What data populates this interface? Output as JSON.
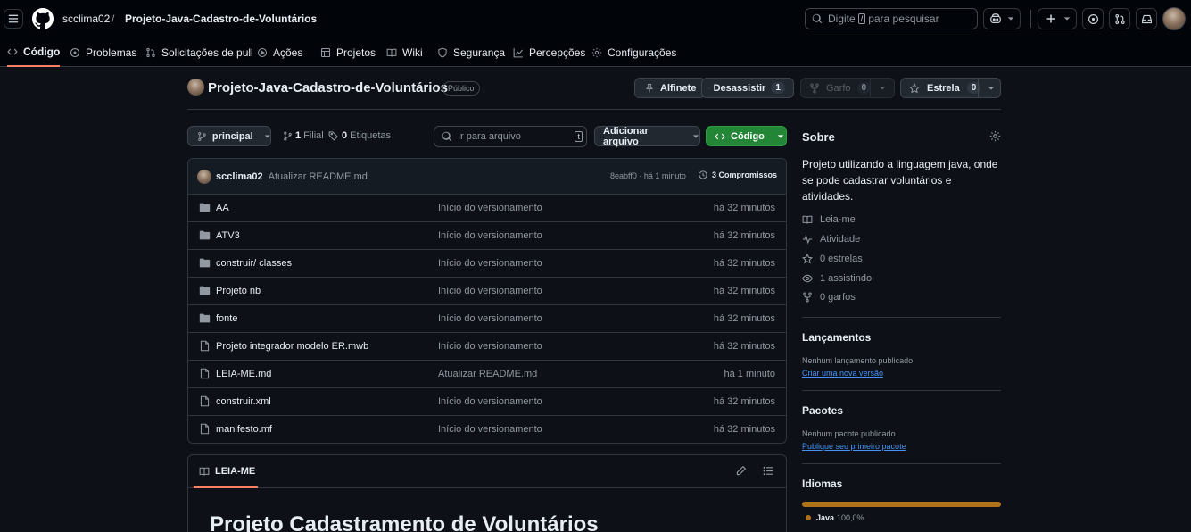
{
  "topbar": {
    "owner": "scclima02",
    "separator": "/",
    "repo": "Projeto-Java-Cadastro-de-Voluntários",
    "search_prefix": "Digite",
    "search_key": "/",
    "search_suffix": "para pesquisar"
  },
  "nav": {
    "items": [
      {
        "label": "Código"
      },
      {
        "label": "Problemas"
      },
      {
        "label": "Solicitações de pull"
      },
      {
        "label": "Ações"
      },
      {
        "label": "Projetos"
      },
      {
        "label": "Wiki"
      },
      {
        "label": "Segurança"
      },
      {
        "label": "Percepções"
      },
      {
        "label": "Configurações"
      }
    ]
  },
  "repo_header": {
    "title": "Projeto-Java-Cadastro-de-Voluntários",
    "visibility": "Público",
    "pin_label": "Alfinete",
    "watch_label": "Desassistir",
    "watch_count": "1",
    "fork_label": "Garfo",
    "fork_count": "0",
    "star_label": "Estrela",
    "star_count": "0"
  },
  "toolbar": {
    "branch": "principal",
    "branches_count": "1",
    "branches_label": "Filial",
    "tags_count": "0",
    "tags_label": "Etiquetas",
    "search_placeholder": "Ir para arquivo",
    "search_key": "t",
    "add_file_label": "Adicionar arquivo",
    "code_label": "Código"
  },
  "commit": {
    "author": "scclima02",
    "message": "Atualizar README.md",
    "hash_time": "8eabff0 · há 1 minuto",
    "commits_label": "3 Compromissos"
  },
  "files": [
    {
      "type": "folder",
      "name": "AA",
      "message": "Início do versionamento",
      "date": "há 32 minutos"
    },
    {
      "type": "folder",
      "name": "ATV3",
      "message": "Início do versionamento",
      "date": "há 32 minutos"
    },
    {
      "type": "folder",
      "name": "construir/ classes",
      "message": "Início do versionamento",
      "date": "há 32 minutos"
    },
    {
      "type": "folder",
      "name": "Projeto nb",
      "message": "Início do versionamento",
      "date": "há 32 minutos"
    },
    {
      "type": "folder",
      "name": "fonte",
      "message": "Início do versionamento",
      "date": "há 32 minutos"
    },
    {
      "type": "file",
      "name": "Projeto integrador modelo ER.mwb",
      "message": "Início do versionamento",
      "date": "há 32 minutos"
    },
    {
      "type": "file",
      "name": "LEIA-ME.md",
      "message": "Atualizar README.md",
      "date": "há 1 minuto"
    },
    {
      "type": "file",
      "name": "construir.xml",
      "message": "Início do versionamento",
      "date": "há 32 minutos"
    },
    {
      "type": "file",
      "name": "manifesto.mf",
      "message": "Início do versionamento",
      "date": "há 32 minutos"
    }
  ],
  "readme": {
    "tab_label": "LEIA-ME",
    "heading": "Projeto Cadastramento de Voluntários"
  },
  "about": {
    "title": "Sobre",
    "description": "Projeto utilizando a linguagem java, onde se pode cadastrar voluntários e atividades.",
    "stats": [
      {
        "icon": "book-icon",
        "label": "Leia-me"
      },
      {
        "icon": "pulse-icon",
        "label": "Atividade"
      },
      {
        "icon": "star-icon",
        "label": "0 estrelas"
      },
      {
        "icon": "eye-icon",
        "label": "1 assistindo"
      },
      {
        "icon": "fork-icon",
        "label": "0 garfos"
      }
    ]
  },
  "releases": {
    "title": "Lançamentos",
    "empty_text": "Nenhum lançamento publicado",
    "link": "Criar uma nova versão"
  },
  "packages": {
    "title": "Pacotes",
    "empty_text": "Nenhum pacote publicado",
    "link": "Publique seu primeiro pacote"
  },
  "languages": {
    "title": "Idiomas",
    "items": [
      {
        "name": "Java",
        "percent": "100,0%",
        "color": "#b07219",
        "fraction": 1.0
      }
    ]
  },
  "colors": {
    "accent_green": "#238636",
    "java": "#b07219",
    "link": "#4493f8",
    "active_tab": "#f78166"
  }
}
